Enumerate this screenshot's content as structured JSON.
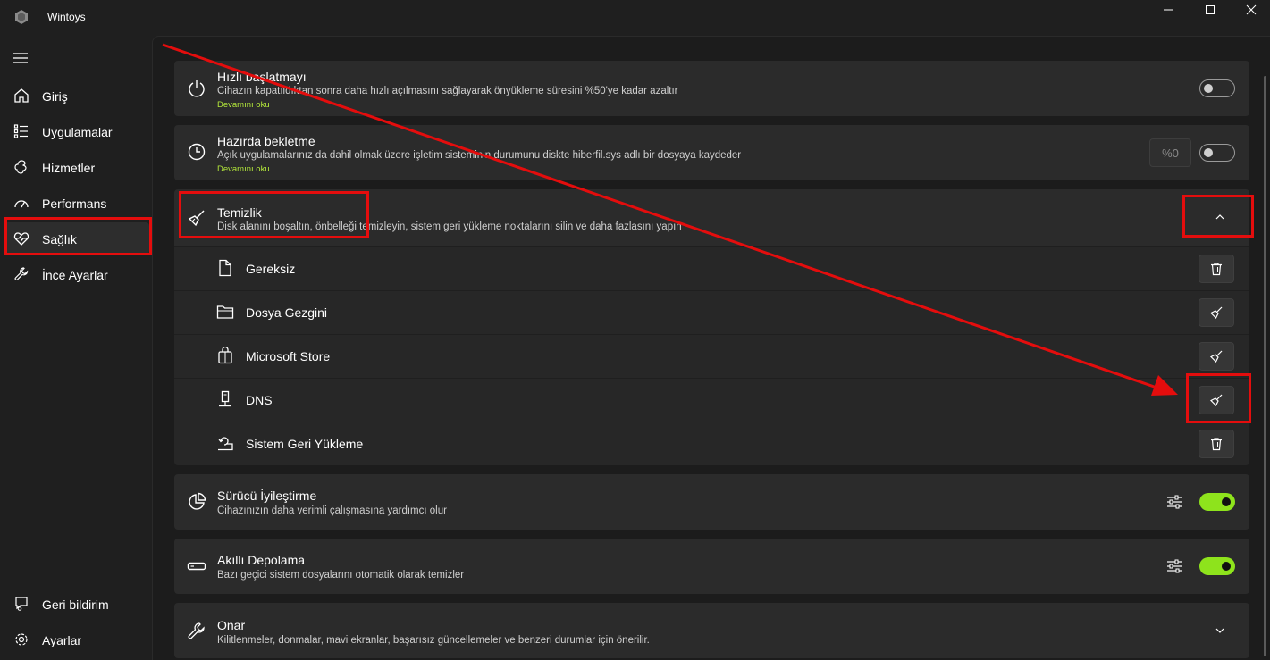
{
  "app": {
    "title": "Wintoys",
    "icon": "wintoys-logo-icon"
  },
  "window_controls": {
    "minimize": "minimize-icon",
    "maximize": "maximize-icon",
    "close": "close-icon"
  },
  "sidebar": {
    "menu_icon": "hamburger-icon",
    "items": [
      {
        "label": "Giriş",
        "icon": "home-icon"
      },
      {
        "label": "Uygulamalar",
        "icon": "apps-list-icon"
      },
      {
        "label": "Hizmetler",
        "icon": "services-icon"
      },
      {
        "label": "Performans",
        "icon": "performance-icon"
      },
      {
        "label": "Sağlık",
        "icon": "health-heart-icon",
        "active": true
      },
      {
        "label": "İnce Ayarlar",
        "icon": "wrench-icon"
      }
    ],
    "bottom_items": [
      {
        "label": "Geri bildirim",
        "icon": "feedback-icon"
      },
      {
        "label": "Ayarlar",
        "icon": "gear-icon"
      }
    ]
  },
  "cards": {
    "fast_startup": {
      "title": "Hızlı başlatmayı",
      "desc": "Cihazın kapatıldıktan sonra daha hızlı açılmasını sağlayarak önyükleme süresini %50'ye kadar azaltır",
      "link": "Devamını oku",
      "toggle": "off"
    },
    "hibernate": {
      "title": "Hazırda bekletme",
      "desc": "Açık uygulamalarınız da dahil olmak üzere işletim sisteminin durumunu diskte hiberfil.sys adlı bir dosyaya kaydeder",
      "link": "Devamını oku",
      "percent": "%0",
      "toggle": "off"
    },
    "cleanup": {
      "title": "Temizlik",
      "desc": "Disk alanını boşaltın, önbelleği temizleyin, sistem geri yükleme noktalarını silin ve daha fazlasını yapın",
      "expanded": true,
      "items": [
        {
          "label": "Gereksiz",
          "icon": "file-icon",
          "action_icon": "trash-icon"
        },
        {
          "label": "Dosya Gezgini",
          "icon": "folder-icon",
          "action_icon": "broom-icon"
        },
        {
          "label": "Microsoft Store",
          "icon": "store-bag-icon",
          "action_icon": "broom-icon"
        },
        {
          "label": "DNS",
          "icon": "dns-icon",
          "action_icon": "broom-icon"
        },
        {
          "label": "Sistem Geri Yükleme",
          "icon": "restore-icon",
          "action_icon": "trash-icon"
        }
      ]
    },
    "driver": {
      "title": "Sürücü İyileştirme",
      "desc": "Cihazınızın daha verimli çalışmasına yardımcı olur",
      "toggle": "on"
    },
    "storage": {
      "title": "Akıllı Depolama",
      "desc": "Bazı geçici sistem dosyalarını otomatik olarak temizler",
      "toggle": "on"
    },
    "repair": {
      "title": "Onar",
      "desc": "Kilitlenmeler, donmalar, mavi ekranlar, başarısız güncellemeler ve benzeri durumlar için önerilir."
    }
  },
  "colors": {
    "accent": "#8ee31c",
    "annotation": "#e40d0d",
    "background": "#1c1c1c",
    "card": "#2b2b2b"
  }
}
